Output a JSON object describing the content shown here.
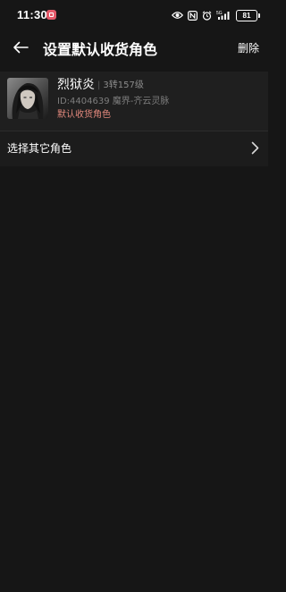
{
  "status_bar": {
    "time": "11:30",
    "battery": "81"
  },
  "header": {
    "title": "设置默认收货角色",
    "delete_label": "删除"
  },
  "role": {
    "name": "烈狱炎",
    "level": "3转157级",
    "id_line": "ID:4404639 魔界-齐云灵脉",
    "default_tag": "默认收货角色"
  },
  "select_other": {
    "label": "选择其它角色"
  },
  "icons": {
    "status_app": "app-notification-icon",
    "eye": "eye-icon",
    "nfc": "nfc-icon",
    "alarm": "alarm-icon",
    "signal": "signal-5g-icon",
    "back": "arrow-left-icon",
    "chevron": "chevron-right-icon"
  },
  "colors": {
    "background": "#161616",
    "card": "#1f1f1f",
    "default_tag": "#e3897d",
    "muted_text": "#7d7d7d"
  }
}
